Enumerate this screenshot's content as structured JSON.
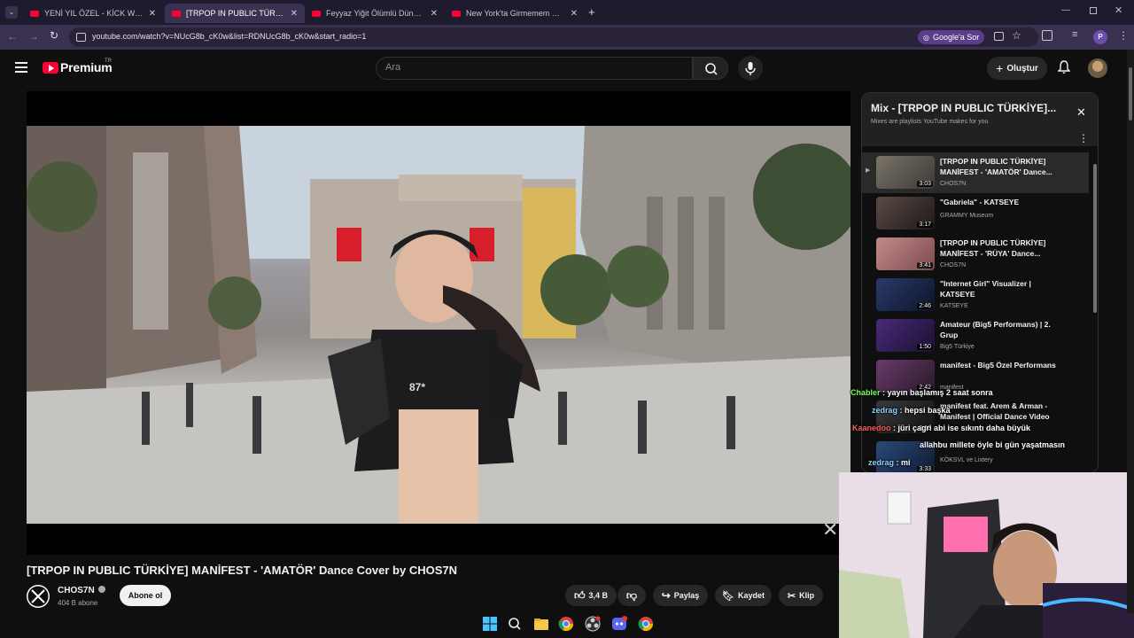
{
  "browser": {
    "tabs": [
      {
        "label": "YENİ YIL ÖZEL - KİCK WRAPPED",
        "active": false
      },
      {
        "label": "[TRPOP IN PUBLIC TÜRKİYE] MA",
        "active": true
      },
      {
        "label": "Feyyaz Yiğit Ölümlü Dünya Sah",
        "active": false
      },
      {
        "label": "New York'ta Girmemem Gereke",
        "active": false
      }
    ],
    "url": "youtube.com/watch?v=NUcG8b_cK0w&list=RDNUcG8b_cK0w&start_radio=1",
    "google_ask_label": "Google'a Sor",
    "profile_initial": "P"
  },
  "youtube": {
    "logo_text": "Premium",
    "region": "TR",
    "search_placeholder": "Ara",
    "create_label": "Oluştur"
  },
  "video": {
    "title": "[TRPOP IN PUBLIC TÜRKİYE] MANİFEST - 'AMATÖR' Dance Cover by CHOS7N",
    "shirt_text": "87*",
    "channel": {
      "name": "CHOS7N",
      "subscribers": "404 B abone",
      "subscribe_label": "Abone ol"
    },
    "actions": {
      "likes": "3,4 B",
      "share": "Paylaş",
      "save": "Kaydet",
      "clip": "Klip"
    }
  },
  "mix": {
    "title": "Mix - [TRPOP IN PUBLIC TÜRKİYE]...",
    "subtitle": "Mixes are playlists YouTube makes for you",
    "items": [
      {
        "title": "[TRPOP IN PUBLIC TÜRKİYE] MANİFEST - 'AMATÖR' Dance...",
        "channel": "CHOS7N",
        "duration": "3:03",
        "current": true
      },
      {
        "title": "\"Gabriela\" - KATSEYE",
        "channel": "GRAMMY Museum",
        "duration": "3:17"
      },
      {
        "title": "[TRPOP IN PUBLIC TÜRKİYE] MANİFEST - 'RÜYA' Dance...",
        "channel": "CHOS7N",
        "duration": "3:41"
      },
      {
        "title": "\"Internet Girl\" Visualizer | KATSEYE",
        "channel": "KATSEYE",
        "duration": "2:46"
      },
      {
        "title": "Amateur (Big5 Performans) | 2. Grup",
        "channel": "Big5 Türkiye",
        "duration": "1:50"
      },
      {
        "title": "manifest - Big5 Özel Performans",
        "channel": "manifest",
        "duration": "2:42"
      },
      {
        "title": "manifest feat. Arem & Arman - Manifest | Official Dance Video",
        "channel": "",
        "duration": "2:53"
      },
      {
        "title": "",
        "channel": "KÖKSVL ve Lixtery",
        "duration": "3:33"
      }
    ]
  },
  "chat": [
    {
      "user": "Chabler",
      "message": "yayın başlamış 2 saat sonra",
      "color": "#7dff5a"
    },
    {
      "user": "zedrag",
      "message": "hepsi başka",
      "color": "#8fd3ff"
    },
    {
      "user": "Kaanedoo",
      "message": "jüri çagri abi ise sıkıntı daha büyük",
      "color": "#ff5a5a"
    },
    {
      "user": "",
      "message": "allahbu millete öyle bi gün yaşatmasın",
      "color": "#ffffff"
    },
    {
      "user": "zedrag",
      "message": "mi",
      "color": "#8fd3ff"
    }
  ],
  "colors": {
    "youtube_red": "#ff0033",
    "browser_frame": "#1f1b2e",
    "page_bg": "#0f0f0f"
  }
}
